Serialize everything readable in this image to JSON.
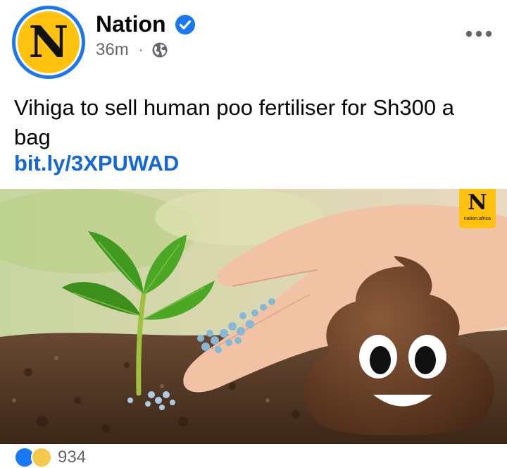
{
  "post": {
    "page_name": "Nation",
    "avatar_letter": "N",
    "time": "36m",
    "text": "Vihiga to sell human poo fertiliser for Sh300 a bag",
    "link": "bit.ly/3XPUWAD",
    "image_badge": {
      "letter": "N",
      "caption": "nation.africa"
    },
    "reactions": {
      "count": "934",
      "types": [
        "like-icon",
        "haha-icon"
      ]
    }
  },
  "colors": {
    "accent_blue": "#1877f2",
    "link_blue": "#1467d8",
    "brand_yellow": "#ffc20e",
    "secondary_text": "#65676b"
  }
}
